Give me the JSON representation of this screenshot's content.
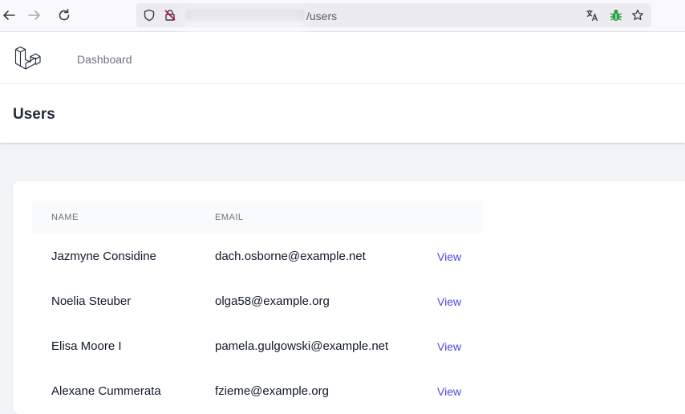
{
  "browser": {
    "url_path": "/users"
  },
  "nav": {
    "dashboard_label": "Dashboard"
  },
  "header": {
    "title": "Users"
  },
  "table": {
    "columns": [
      "NAME",
      "EMAIL"
    ],
    "rows": [
      {
        "name": "Jazmyne Considine",
        "email": "dach.osborne@example.net",
        "action": "View"
      },
      {
        "name": "Noelia Steuber",
        "email": "olga58@example.org",
        "action": "View"
      },
      {
        "name": "Elisa Moore I",
        "email": "pamela.gulgowski@example.net",
        "action": "View"
      },
      {
        "name": "Alexane Cummerata",
        "email": "fzieme@example.org",
        "action": "View"
      }
    ]
  },
  "colors": {
    "link": "#4f46e5",
    "bug_icon": "#2ea043"
  }
}
